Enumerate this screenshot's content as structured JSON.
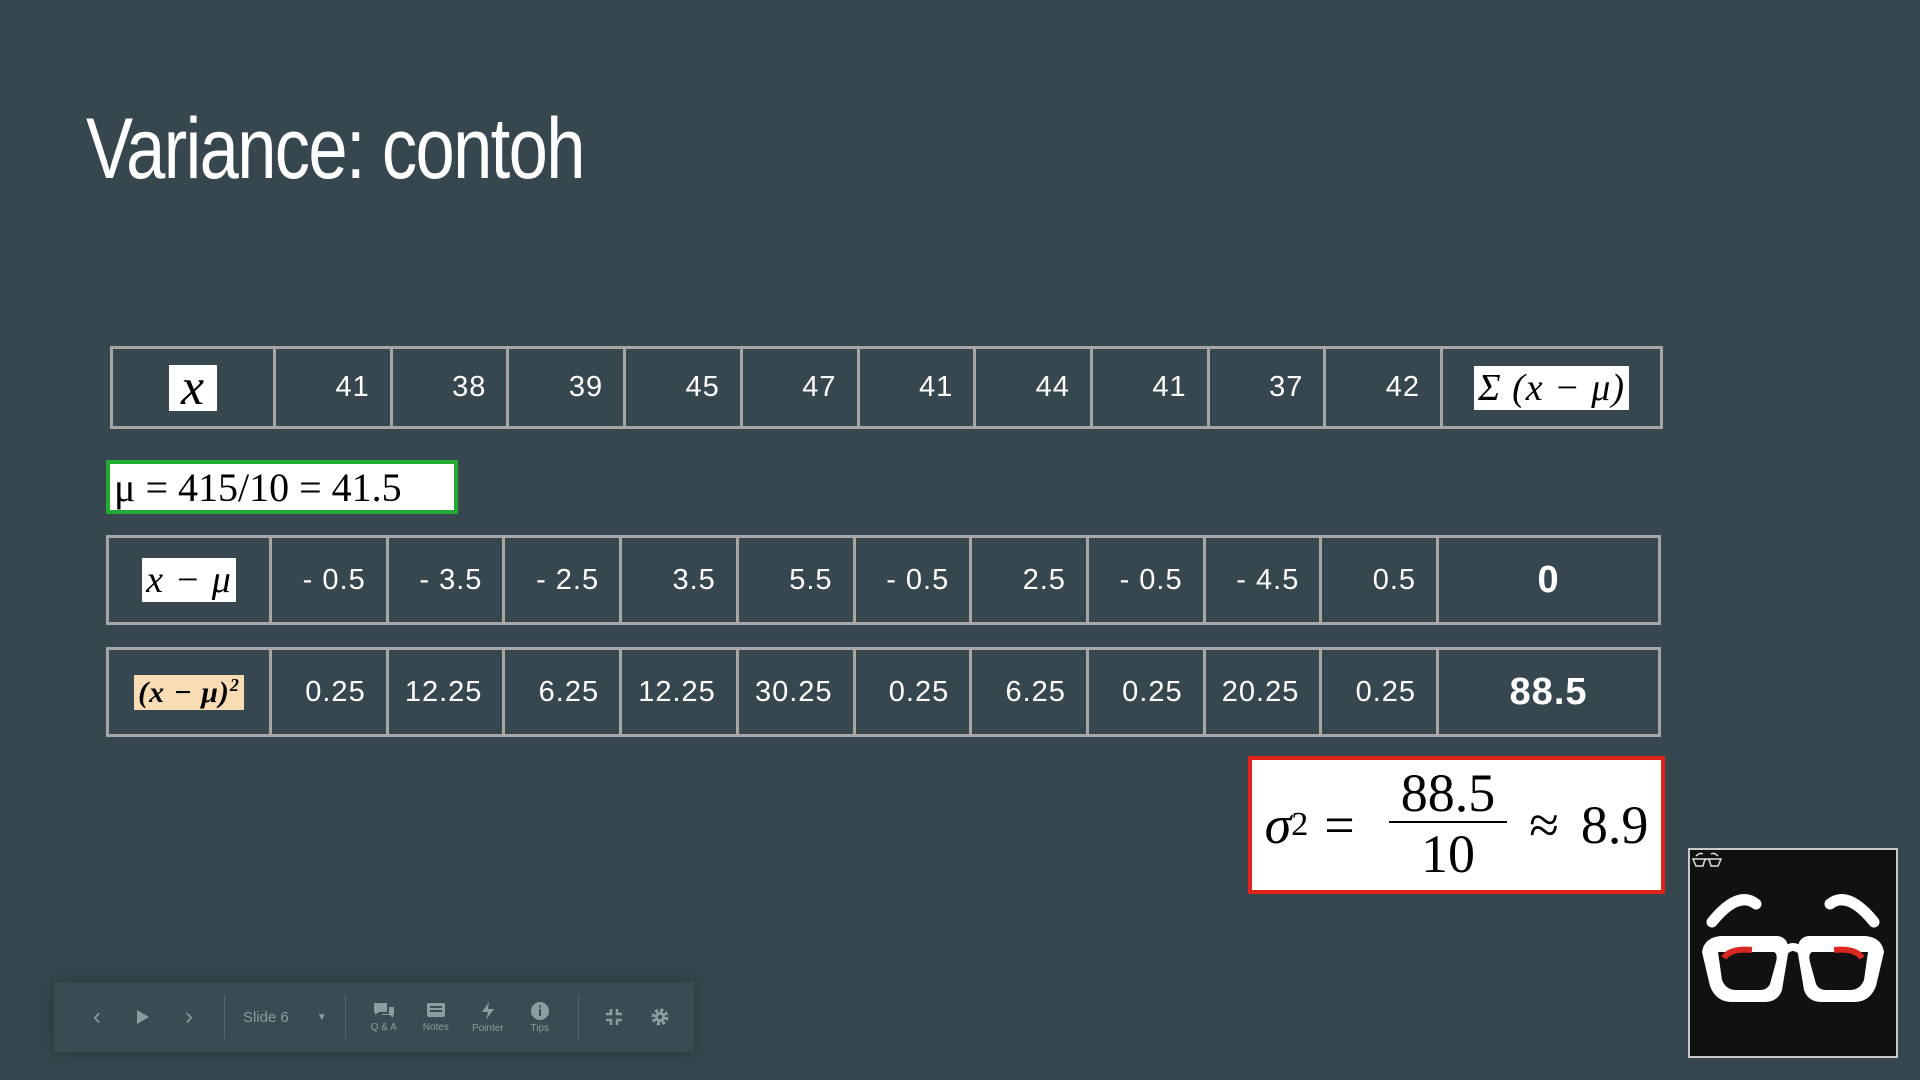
{
  "slide": {
    "title": "Variance: contoh"
  },
  "table": {
    "x_row": {
      "header": "x",
      "values": [
        "41",
        "38",
        "39",
        "45",
        "47",
        "41",
        "44",
        "41",
        "37",
        "42"
      ],
      "sum_label": "Σ (x − μ)"
    },
    "mean": "μ = 415/10 = 41.5",
    "deviation_row": {
      "header": "x − μ",
      "values": [
        "- 0.5",
        "- 3.5",
        "- 2.5",
        "3.5",
        "5.5",
        "- 0.5",
        "2.5",
        "- 0.5",
        "- 4.5",
        "0.5"
      ],
      "sum": "0"
    },
    "squared_row": {
      "header_base": "(x − μ)",
      "header_exp": "2",
      "values": [
        "0.25",
        "12.25",
        "6.25",
        "12.25",
        "30.25",
        "0.25",
        "6.25",
        "0.25",
        "20.25",
        "0.25"
      ],
      "sum": "88.5"
    }
  },
  "variance": {
    "symbol": "σ",
    "exponent": "2",
    "equals": "=",
    "numerator": "88.5",
    "denominator": "10",
    "approx": "≈",
    "result": "8.9"
  },
  "toolbar": {
    "prev_icon": "chevron-left-icon",
    "play_icon": "play-icon",
    "next_icon": "chevron-right-icon",
    "slide_label": "Slide 6",
    "tools": [
      {
        "label": "Q & A",
        "icon": "chat-icon"
      },
      {
        "label": "Notes",
        "icon": "notes-icon"
      },
      {
        "label": "Pointer",
        "icon": "pointer-icon"
      },
      {
        "label": "Tips",
        "icon": "info-icon"
      }
    ]
  },
  "colors": {
    "background": "#37474f",
    "mean_border": "#22aa33",
    "variance_border": "#e2231a",
    "squared_header_bg": "#f7dcb4",
    "cell_border": "#a6a6a6"
  }
}
